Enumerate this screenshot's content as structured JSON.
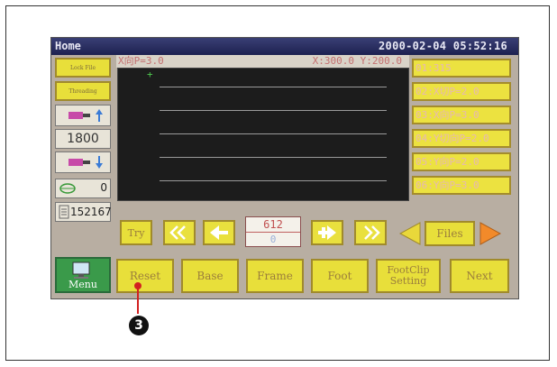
{
  "titlebar": {
    "title": "Home",
    "datetime": "2000-02-04 05:52:16"
  },
  "left_panel": {
    "lock_file_label": "Lock File",
    "threading_label": "Threading",
    "speed_value": "1800",
    "count_value": "0",
    "stitch_count": "152167"
  },
  "display": {
    "x_pitch": "X向P=3.0",
    "coord": "X:300.0 Y:200.0"
  },
  "param_list": [
    "01:315",
    "02:X切P=2.0",
    "03:X向P=3.0",
    "04:Y切向P=2.0",
    "05:Y向P=2.0",
    "06:Y向P=3.0"
  ],
  "nav_row": {
    "try_label": "Try",
    "counter_top": "612",
    "counter_bottom": "0",
    "files_label": "Files"
  },
  "bottom_row": {
    "menu_label": "Menu",
    "reset_label": "Reset",
    "base_label": "Base",
    "frame_label": "Frame",
    "foot_label": "Foot",
    "footclip_line1": "FootClip",
    "footclip_line2": "Setting",
    "next_label": "Next"
  },
  "callout_number": "3"
}
